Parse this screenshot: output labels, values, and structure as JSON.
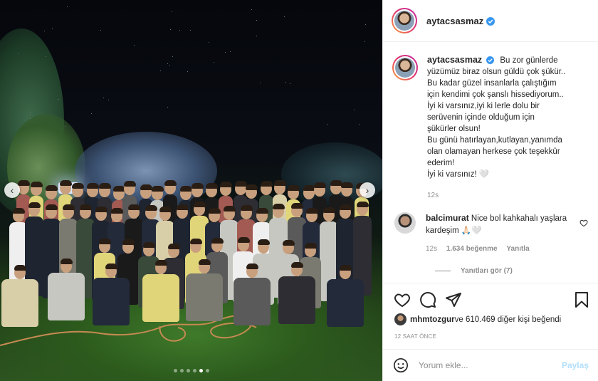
{
  "post": {
    "author": "aytacsasmaz",
    "caption_lines": [
      "Bu zor günlerde",
      "yüzümüz biraz olsun güldü çok şükür..",
      "Bu kadar güzel insanlarla çalıştığım",
      "için kendimi çok şanslı hissediyorum..",
      "İyi ki varsınız,iyi ki lerle dolu bir",
      "serüvenin içinde olduğum için",
      "şükürler olsun!",
      "Bu günü hatırlayan,kutlayan,yanımda",
      "olan olamayan herkese çok teşekkür",
      "ederim!",
      "İyi ki varsınız! 🤍"
    ],
    "caption_time": "12s",
    "posted_ago": "12 SAAT ÖNCE"
  },
  "comment": {
    "username": "balcimurat",
    "text": "Nice bol kahkahalı yaşlara kardeşim 🙏🏻🤍",
    "time": "12s",
    "likes": "1.634 beğenme",
    "reply": "Yanıtla",
    "see_replies": "Yanıtları gör (7)"
  },
  "likes": {
    "user": "mhmtozgur",
    "rest": " ve 610.469 diğer kişi beğendi"
  },
  "add_comment": {
    "placeholder": "Yorum ekle...",
    "post_label": "Paylaş"
  },
  "carousel": {
    "prev_glyph": "‹",
    "next_glyph": "›",
    "count": 6,
    "active_index": 4
  },
  "colors": {
    "verified": "#3897f0",
    "ring_start": "#f9a93a",
    "ring_end": "#c32aa3",
    "post_button": "#b2dffc"
  }
}
